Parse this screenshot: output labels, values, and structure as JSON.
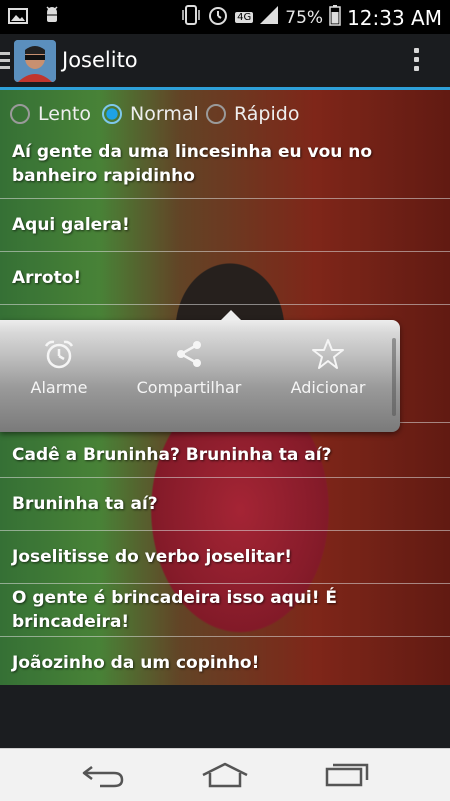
{
  "status_bar": {
    "network": "4G",
    "battery": "75%",
    "time": "12:33 AM"
  },
  "action_bar": {
    "title": "Joselito"
  },
  "speed_options": [
    {
      "label": "Lento",
      "selected": false
    },
    {
      "label": "Normal",
      "selected": true
    },
    {
      "label": "Rápido",
      "selected": false
    }
  ],
  "list": [
    "Aí gente da uma lincesinha eu vou no banheiro rapidinho",
    "Aqui galera!",
    "Arroto!",
    "",
    "Cadê a Bruninha? Bruninha ta aí?",
    "Bruninha ta aí?",
    "Joselitisse do verbo joselitar!",
    "O gente é brincadeira isso aqui! É brincadeira!",
    "Joãozinho da um copinho!"
  ],
  "popup": {
    "items": [
      {
        "label": "Alarme",
        "icon": "alarm-clock-icon"
      },
      {
        "label": "Compartilhar",
        "icon": "share-icon"
      },
      {
        "label": "Adicionar",
        "icon": "star-icon"
      }
    ]
  },
  "navigation": {
    "back": "back-icon",
    "home": "home-icon",
    "recents": "recents-icon"
  },
  "colors": {
    "accent": "#2ea0d8",
    "radio_selected": "#1ea2e6"
  }
}
